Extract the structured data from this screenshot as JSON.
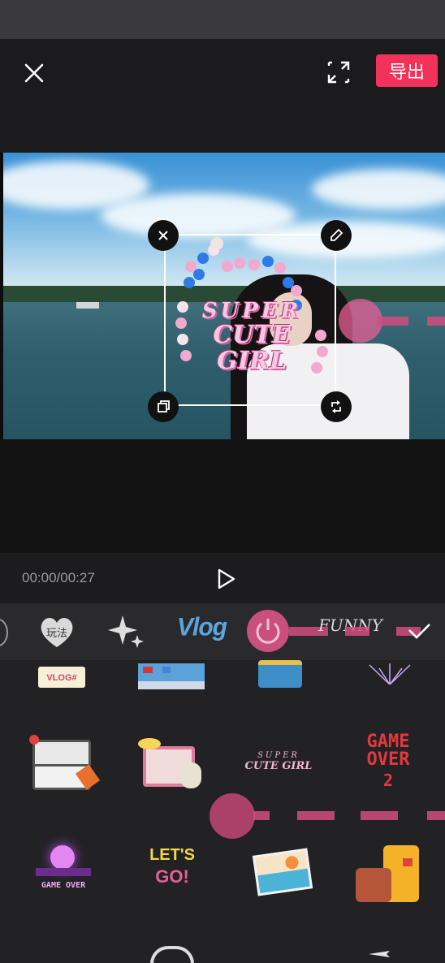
{
  "header": {
    "export_label": "导出"
  },
  "preview": {
    "sticker_line1": "SUPER",
    "sticker_line2": "CUTE GIRL"
  },
  "controls": {
    "time": "00:00/00:27"
  },
  "categories": {
    "items": [
      {
        "name": "heart-tab",
        "label": "玩法"
      },
      {
        "name": "sparkle-tab",
        "label": ""
      },
      {
        "name": "vlog-tab",
        "label": "Vlog"
      },
      {
        "name": "power-tab",
        "label": ""
      },
      {
        "name": "funny-tab",
        "label": "FUNNY"
      }
    ]
  },
  "stickers": {
    "vlog_tag": "VLOG#",
    "super_cute_line1": "SUPER",
    "super_cute_line2": "CUTE GIRL",
    "game_over_line1": "GAME",
    "game_over_line2": "OVER",
    "game_over_num": "2",
    "game_over_small": "GAME OVER",
    "lets_go_line1": "LET'S",
    "lets_go_line2": "GO!"
  },
  "colors": {
    "accent": "#f3325b",
    "overlay_pink": "#e85f96",
    "vlog_blue": "#5aa6df"
  }
}
